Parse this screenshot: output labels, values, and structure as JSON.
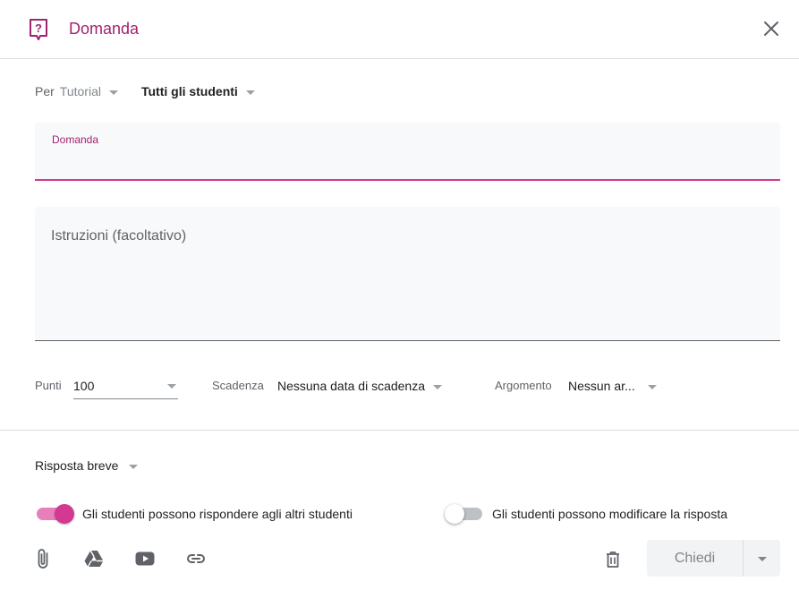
{
  "header": {
    "title": "Domanda",
    "question_icon": "question-box-icon",
    "close_icon": "close-icon"
  },
  "audience": {
    "for_label": "Per",
    "class_value": "Tutorial",
    "students_value": "Tutti gli studenti"
  },
  "question_field": {
    "label": "Domanda",
    "value": ""
  },
  "instructions_field": {
    "placeholder": "Istruzioni (facoltativo)"
  },
  "meta": {
    "points_label": "Punti",
    "points_value": "100",
    "due_label": "Scadenza",
    "due_value": "Nessuna data di scadenza",
    "topic_label": "Argomento",
    "topic_value": "Nessun ar..."
  },
  "answer_type": {
    "value": "Risposta breve"
  },
  "toggles": [
    {
      "label": "Gli studenti possono rispondere agli altri studenti",
      "on": true
    },
    {
      "label": "Gli studenti possono modificare la risposta",
      "on": false
    }
  ],
  "attachments": [
    "paperclip-icon",
    "google-drive-icon",
    "youtube-icon",
    "link-icon"
  ],
  "actions": {
    "delete_icon": "trash-icon",
    "ask_label": "Chiedi"
  },
  "colors": {
    "accent": "#a1236f",
    "accent_bright": "#d33990"
  }
}
